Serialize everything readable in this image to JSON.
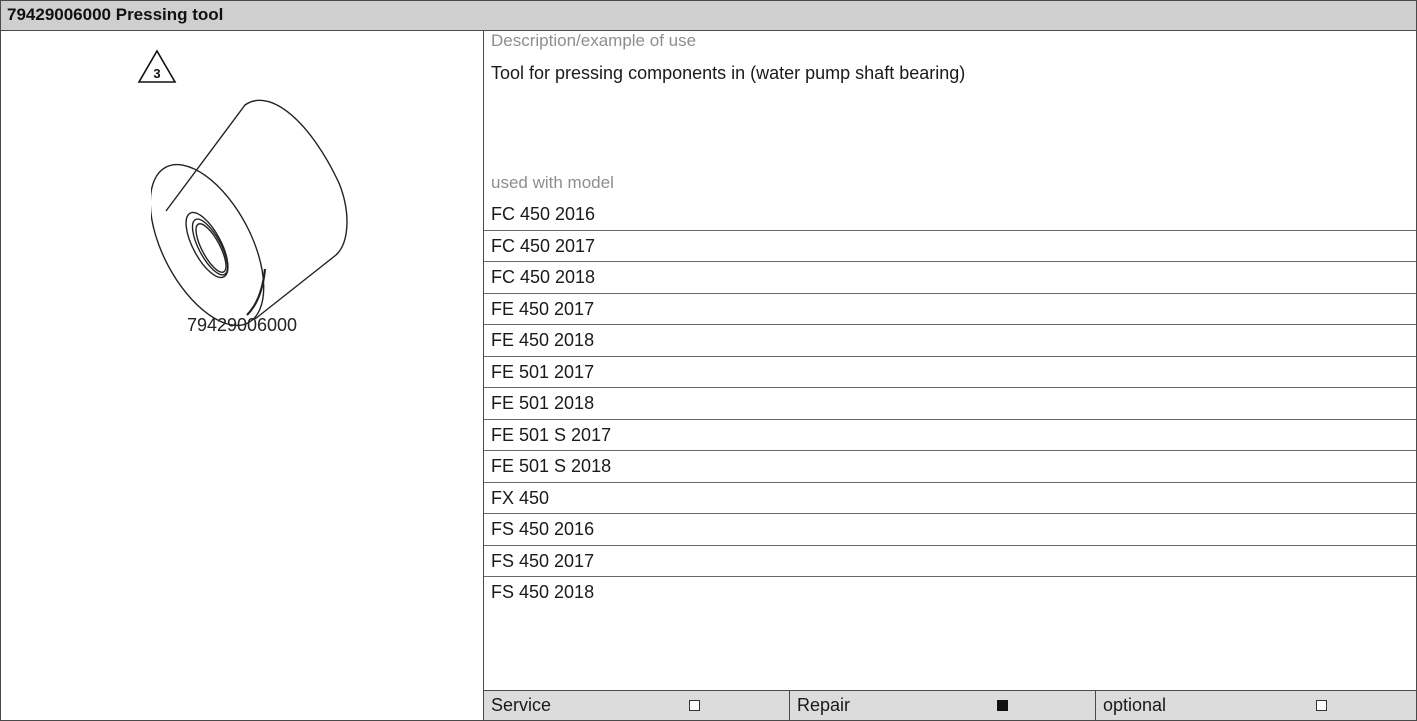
{
  "title": "79429006000 Pressing tool",
  "image": {
    "part_number": "79429006000",
    "warning_icon_number": "3"
  },
  "description": {
    "heading": "Description/example of use",
    "text": "Tool for pressing components in (water pump shaft bearing)"
  },
  "models": {
    "heading": "used with model",
    "items": [
      "FC 450 2016",
      "FC 450 2017",
      "FC 450 2018",
      "FE 450 2017",
      "FE 450 2018",
      "FE 501 2017",
      "FE 501 2018",
      "FE 501 S 2017",
      "FE 501 S 2018",
      "FX 450",
      "FS 450 2016",
      "FS 450 2017",
      "FS 450 2018"
    ]
  },
  "categories": [
    {
      "label": "Service",
      "checked": false
    },
    {
      "label": "Repair",
      "checked": true
    },
    {
      "label": "optional",
      "checked": false
    }
  ]
}
